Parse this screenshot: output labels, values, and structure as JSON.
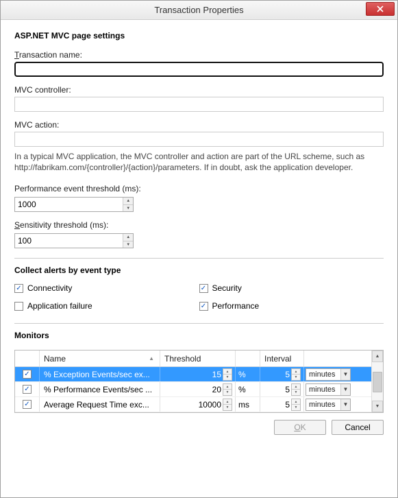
{
  "window": {
    "title": "Transaction Properties"
  },
  "section1": {
    "title": "ASP.NET MVC page settings",
    "tname_label_pre": "T",
    "tname_label_post": "ransaction name:",
    "tname_value": "",
    "controller_label": "MVC controller:",
    "controller_value": "",
    "action_label": "MVC action:",
    "action_value": "",
    "help": "In a typical MVC application, the MVC controller and action are part of the URL scheme, such as http://fabrikam.com/{controller}/{action}/parameters. If in doubt, ask the application developer.",
    "perf_label": "Performance event threshold (ms):",
    "perf_value": "1000",
    "sens_label_pre": "S",
    "sens_label_post": "ensitivity threshold (ms):",
    "sens_value": "100"
  },
  "alerts": {
    "title": "Collect alerts by event type",
    "connectivity": {
      "label": "Connectivity",
      "checked": true
    },
    "security": {
      "label": "Security",
      "checked": true
    },
    "appfail": {
      "label": "Application failure",
      "checked": false
    },
    "performance": {
      "label": "Performance",
      "checked": true
    }
  },
  "monitors": {
    "title": "Monitors",
    "headers": {
      "name": "Name",
      "threshold": "Threshold",
      "interval": "Interval"
    },
    "rows": [
      {
        "checked": true,
        "name": "% Exception Events/sec ex...",
        "threshold": "15",
        "unit": "%",
        "interval": "5",
        "period": "minutes",
        "selected": true
      },
      {
        "checked": true,
        "name": "% Performance Events/sec ...",
        "threshold": "20",
        "unit": "%",
        "interval": "5",
        "period": "minutes",
        "selected": false
      },
      {
        "checked": true,
        "name": "Average Request Time exc...",
        "threshold": "10000",
        "unit": "ms",
        "interval": "5",
        "period": "minutes",
        "selected": false
      }
    ]
  },
  "footer": {
    "ok_pre": "O",
    "ok_post": "K",
    "cancel": "Cancel"
  }
}
